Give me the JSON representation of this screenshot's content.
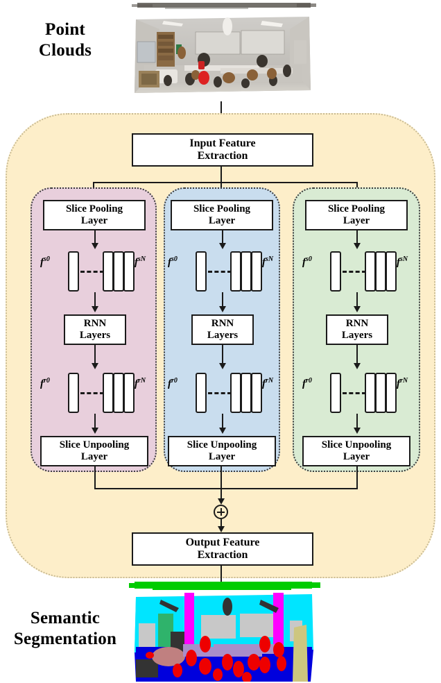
{
  "figure": {
    "top_label": "Point Clouds",
    "top_label_lines": [
      "Point",
      "Clouds"
    ],
    "bottom_label": "Semantic Segmentation",
    "bottom_label_lines": [
      "Semantic",
      "Segmentation"
    ]
  },
  "colors": {
    "container_fill": "#fdeec9",
    "container_border": "#c9bb93",
    "branch_pink": "#e8cfdc",
    "branch_blue": "#c9ddee",
    "branch_green": "#d9ebd3",
    "box_fill": "#ffffff",
    "line": "#1a1a1a",
    "seg_ceiling": "#00cc00",
    "seg_wall": "#00e5ff",
    "seg_column": "#ff00ff",
    "seg_floor": "#0000dd",
    "seg_table": "#a98ec9",
    "seg_chair": "#ee0000",
    "seg_board": "#c8c8c8",
    "seg_door": "#cdc67f",
    "seg_bookcase": "#2fb36b",
    "seg_sofa": "#c08080",
    "seg_clutter": "#333333"
  },
  "pipeline": {
    "input_block": {
      "lines": [
        "Input Feature",
        "Extraction"
      ]
    },
    "output_block": {
      "lines": [
        "Output Feature",
        "Extraction"
      ]
    },
    "sum_node": {
      "symbol": "+",
      "name": "element-wise-sum"
    }
  },
  "branches": [
    {
      "id": "branch-0",
      "color": "#e8cfdc",
      "slice_pooling": {
        "lines": [
          "Slice Pooling",
          "Layer"
        ]
      },
      "pooled_features": {
        "left_label": "f",
        "left_sup": "s0",
        "right_label": "f",
        "right_sup": "sN"
      },
      "rnn": {
        "lines": [
          "RNN",
          "Layers"
        ]
      },
      "rnn_features": {
        "left_label": "f",
        "left_sup": "r0",
        "right_label": "f",
        "right_sup": "rN"
      },
      "slice_unpooling": {
        "lines": [
          "Slice Unpooling",
          "Layer"
        ]
      }
    },
    {
      "id": "branch-1",
      "color": "#c9ddee",
      "slice_pooling": {
        "lines": [
          "Slice Pooling",
          "Layer"
        ]
      },
      "pooled_features": {
        "left_label": "f",
        "left_sup": "s0",
        "right_label": "f",
        "right_sup": "sN"
      },
      "rnn": {
        "lines": [
          "RNN",
          "Layers"
        ]
      },
      "rnn_features": {
        "left_label": "f",
        "left_sup": "r0",
        "right_label": "f",
        "right_sup": "rN"
      },
      "slice_unpooling": {
        "lines": [
          "Slice Unpooling",
          "Layer"
        ]
      }
    },
    {
      "id": "branch-2",
      "color": "#d9ebd3",
      "slice_pooling": {
        "lines": [
          "Slice Pooling",
          "Layer"
        ]
      },
      "pooled_features": {
        "left_label": "f",
        "left_sup": "s0",
        "right_label": "f",
        "right_sup": "sN"
      },
      "rnn": {
        "lines": [
          "RNN",
          "Layers"
        ]
      },
      "rnn_features": {
        "left_label": "f",
        "left_sup": "r0",
        "right_label": "f",
        "right_sup": "rN"
      },
      "slice_unpooling": {
        "lines": [
          "Slice Unpooling",
          "Layer"
        ]
      }
    }
  ]
}
